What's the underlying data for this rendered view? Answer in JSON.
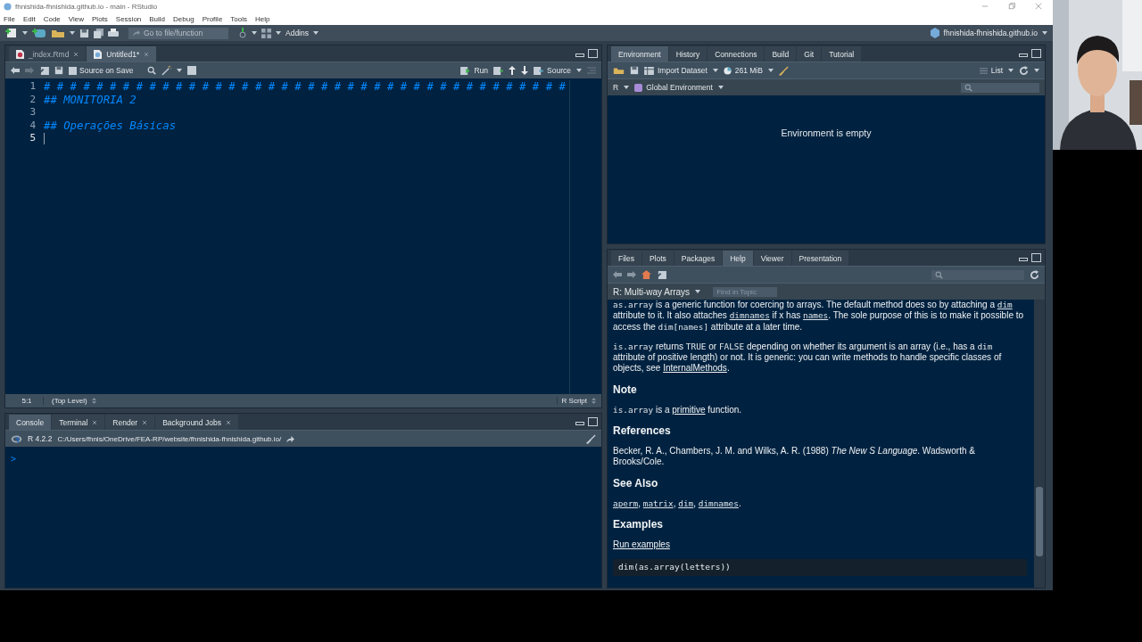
{
  "window": {
    "title": "fhnishida-fhnishida.github.io - main - RStudio"
  },
  "menu": [
    "File",
    "Edit",
    "Code",
    "View",
    "Plots",
    "Session",
    "Build",
    "Debug",
    "Profile",
    "Tools",
    "Help"
  ],
  "toolbar": {
    "goto_placeholder": "Go to file/function",
    "addins": "Addins",
    "project": "fhnishida-fhnishida.github.io"
  },
  "source_pane": {
    "tabs": [
      {
        "label": "_index.Rmd",
        "selected": false,
        "closable": true
      },
      {
        "label": "Untitled1*",
        "selected": true,
        "closable": true
      }
    ],
    "source_on_save": {
      "label": "Source on Save",
      "checked": false
    },
    "run": "Run",
    "source": "Source",
    "lines": [
      {
        "number": "1",
        "text": "# # # # # # # # # # # # # # # # # # # # # # # # # # # # # # # # # # # # # # # #",
        "cursor": false
      },
      {
        "number": "2",
        "text": "## MONITORIA 2",
        "cursor": false
      },
      {
        "number": "3",
        "cursor": false
      },
      {
        "number": "4",
        "text": "## Operações Básicas",
        "cursor": false
      },
      {
        "number": "5",
        "cursor": true
      }
    ],
    "status": {
      "position": "5:1",
      "scope": "(Top Level)",
      "filetype": "R Script"
    }
  },
  "console_pane": {
    "tabs": [
      {
        "label": "Console",
        "selected": true,
        "closable": false
      },
      {
        "label": "Terminal",
        "selected": false,
        "closable": true
      },
      {
        "label": "Render",
        "selected": false,
        "closable": true
      },
      {
        "label": "Background Jobs",
        "selected": false,
        "closable": true
      }
    ],
    "r_version": "R 4.2.2",
    "path": "C:/Users/fhnis/OneDrive/FEA-RP/website/fhnishida-fhnishida.github.io/",
    "prompt": ">"
  },
  "environment_pane": {
    "tabs": [
      {
        "label": "Environment",
        "selected": true
      },
      {
        "label": "History",
        "selected": false
      },
      {
        "label": "Connections",
        "selected": false
      },
      {
        "label": "Build",
        "selected": false
      },
      {
        "label": "Git",
        "selected": false
      },
      {
        "label": "Tutorial",
        "selected": false
      }
    ],
    "import_dataset": "Import Dataset",
    "memory": "261 MiB",
    "view": "List",
    "language": "R",
    "scope": "Global Environment",
    "empty_message": "Environment is empty"
  },
  "help_pane": {
    "tabs": [
      {
        "label": "Files",
        "selected": false
      },
      {
        "label": "Plots",
        "selected": false
      },
      {
        "label": "Packages",
        "selected": false
      },
      {
        "label": "Help",
        "selected": true
      },
      {
        "label": "Viewer",
        "selected": false
      },
      {
        "label": "Presentation",
        "selected": false
      }
    ],
    "topic": "R: Multi-way Arrays",
    "find_placeholder": "Find in Topic",
    "content": [
      {
        "kind": "paragraph",
        "segments": [
          {
            "kind": "code",
            "text": "as.array"
          },
          {
            "kind": "text",
            "text": " is a generic function for coercing to arrays. The default method does so by attaching a "
          },
          {
            "kind": "code-link",
            "text": "dim"
          },
          {
            "kind": "text",
            "text": " attribute to it. It also attaches "
          },
          {
            "kind": "code-link",
            "text": "dimnames"
          },
          {
            "kind": "text",
            "text": " if x has "
          },
          {
            "kind": "code-link",
            "text": "names"
          },
          {
            "kind": "text",
            "text": ". The sole purpose of this is to make it possible to access the "
          },
          {
            "kind": "code",
            "text": "dim[names]"
          },
          {
            "kind": "text",
            "text": " attribute at a later time."
          }
        ]
      },
      {
        "kind": "paragraph",
        "segments": [
          {
            "kind": "code",
            "text": "is.array"
          },
          {
            "kind": "text",
            "text": " returns "
          },
          {
            "kind": "code",
            "text": "TRUE"
          },
          {
            "kind": "text",
            "text": " or "
          },
          {
            "kind": "code",
            "text": "FALSE"
          },
          {
            "kind": "text",
            "text": " depending on whether its argument is an array (i.e., has a "
          },
          {
            "kind": "code",
            "text": "dim"
          },
          {
            "kind": "text",
            "text": " attribute of positive length) or not. It is generic: you can write methods to handle specific classes of objects, see "
          },
          {
            "kind": "link",
            "text": "InternalMethods"
          },
          {
            "kind": "text",
            "text": "."
          }
        ]
      },
      {
        "kind": "heading",
        "text": "Note"
      },
      {
        "kind": "paragraph",
        "segments": [
          {
            "kind": "code",
            "text": "is.array"
          },
          {
            "kind": "text",
            "text": " is a "
          },
          {
            "kind": "link",
            "text": "primitive"
          },
          {
            "kind": "text",
            "text": " function."
          }
        ]
      },
      {
        "kind": "heading",
        "text": "References"
      },
      {
        "kind": "paragraph",
        "segments": [
          {
            "kind": "text",
            "text": "Becker, R. A., Chambers, J. M. and Wilks, A. R. (1988) "
          },
          {
            "kind": "italic",
            "text": "The New S Language"
          },
          {
            "kind": "text",
            "text": ". Wadsworth & Brooks/Cole."
          }
        ]
      },
      {
        "kind": "heading",
        "text": "See Also"
      },
      {
        "kind": "paragraph",
        "segments": [
          {
            "kind": "code-link",
            "text": "aperm"
          },
          {
            "kind": "text",
            "text": ", "
          },
          {
            "kind": "code-link",
            "text": "matrix"
          },
          {
            "kind": "text",
            "text": ", "
          },
          {
            "kind": "code-link",
            "text": "dim"
          },
          {
            "kind": "text",
            "text": ", "
          },
          {
            "kind": "code-link",
            "text": "dimnames"
          },
          {
            "kind": "text",
            "text": "."
          }
        ]
      },
      {
        "kind": "heading",
        "text": "Examples"
      },
      {
        "kind": "paragraph",
        "segments": [
          {
            "kind": "link",
            "text": "Run examples"
          }
        ]
      },
      {
        "kind": "code-block",
        "text": "dim(as.array(letters))"
      }
    ]
  }
}
